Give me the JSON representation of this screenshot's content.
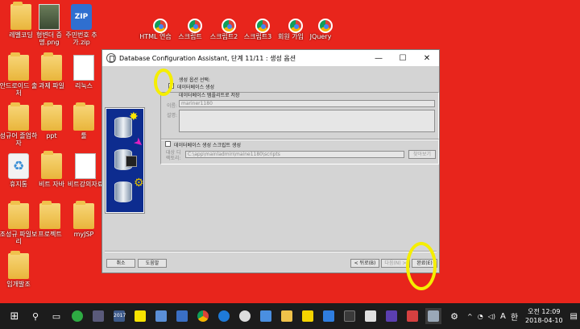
{
  "desktop": {
    "icons": [
      {
        "label": "레벨코딩",
        "type": "folder"
      },
      {
        "label": "형변더 증명.png",
        "type": "photo"
      },
      {
        "label": "주민번호 추가.zip",
        "type": "zip"
      },
      {
        "label": "HTML 연습",
        "type": "chrome"
      },
      {
        "label": "스크립트",
        "type": "chrome"
      },
      {
        "label": "스크립트2",
        "type": "chrome"
      },
      {
        "label": "스크립트3",
        "type": "chrome"
      },
      {
        "label": "회원 가입",
        "type": "chrome"
      },
      {
        "label": "JQuery",
        "type": "chrome"
      },
      {
        "label": "안드로이드 출처",
        "type": "folder"
      },
      {
        "label": "과제 파일",
        "type": "folder"
      },
      {
        "label": "리눅스",
        "type": "doc"
      },
      {
        "label": "성규어 졸업하자",
        "type": "folder"
      },
      {
        "label": "ppt",
        "type": "folder"
      },
      {
        "label": "툴",
        "type": "folder"
      },
      {
        "label": "휴지통",
        "type": "recycle"
      },
      {
        "label": "비트 자바",
        "type": "folder"
      },
      {
        "label": "비트강의자료",
        "type": "doc"
      },
      {
        "label": "조성규 파일보리",
        "type": "folder"
      },
      {
        "label": "프로젝트",
        "type": "folder"
      },
      {
        "label": "myJSP",
        "type": "folder"
      },
      {
        "label": "임개발조",
        "type": "folder"
      }
    ]
  },
  "window": {
    "title": "Database Configuration Assistant, 단계 11/11 : 생성 옵션",
    "minimize_icon": "minimize-icon",
    "maximize_icon": "maximize-icon",
    "close_icon": "close-icon",
    "header_label": "생성 옵션 선택:",
    "create_db_label": "데이터베이스 생성",
    "create_db_checked": true,
    "save_template_label": "데이터베이스 템플리트로 저장",
    "name_label": "이름:",
    "name_value": "mariner1180",
    "description_label": "설명:",
    "description_value": "",
    "script_label": "데이터베이스 생성 스크립트 생성",
    "script_checked": false,
    "dest_label": "대상 디렉토리:",
    "dest_value": "C:\\app\\mainladmin\\maine1180\\scripts",
    "browse_label": "찾아보기",
    "cancel_label": "취소",
    "help_label": "도움말",
    "back_label": "< 뒤로(B)",
    "next_label": "다음(N) >",
    "finish_label": "완료(E)"
  },
  "taskbar": {
    "calendar_badge": "2017",
    "ime_label": "A",
    "lang_label": "한",
    "time": "오전 12:09",
    "date": "2018-04-10"
  },
  "colors": {
    "desktop_bg": "#e8251c",
    "highlight": "#f5ee00",
    "taskbar_bg": "#1c1c1c"
  }
}
